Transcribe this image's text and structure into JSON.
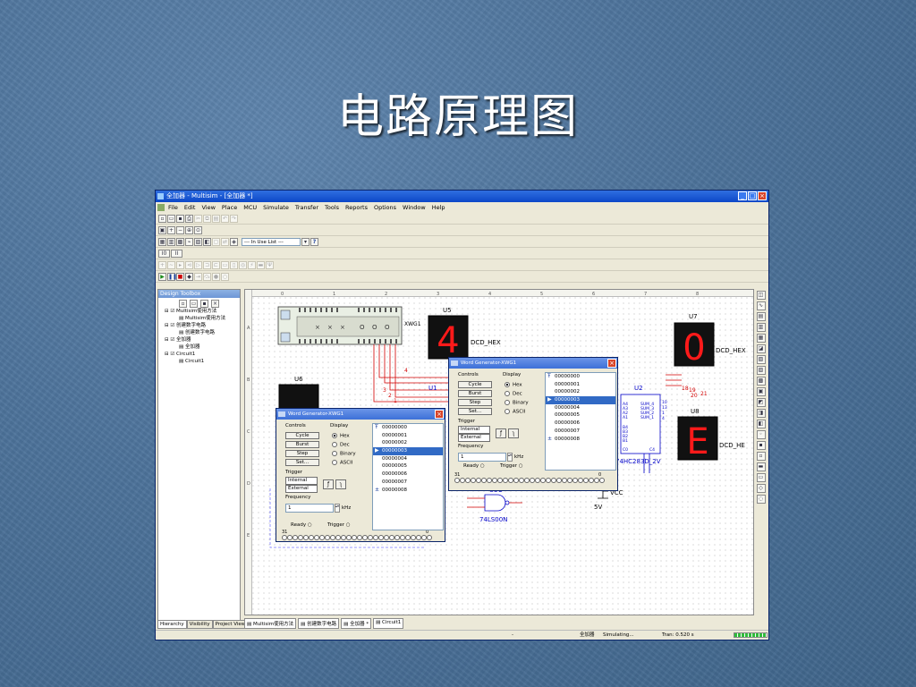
{
  "slide": {
    "title": "电路原理图"
  },
  "window": {
    "title": "全加器 - Multisim - [全加器 *]",
    "menu": [
      "File",
      "Edit",
      "View",
      "Place",
      "MCU",
      "Simulate",
      "Transfer",
      "Tools",
      "Reports",
      "Options",
      "Window",
      "Help"
    ],
    "in_use_list": "--- In Use List ---",
    "statusbar": {
      "sep": "-",
      "file": "全加器",
      "state": "Simulating...",
      "tran": "Tran: 0.520 s"
    }
  },
  "toolbox": {
    "title": "Design Toolbox",
    "tree": [
      {
        "level": 1,
        "label": "Multisim使用方法"
      },
      {
        "level": 2,
        "label": "Multisim使用方法"
      },
      {
        "level": 1,
        "label": "创建数字电路"
      },
      {
        "level": 2,
        "label": "创建数字电路"
      },
      {
        "level": 1,
        "label": "全加器"
      },
      {
        "level": 2,
        "label": "全加器"
      },
      {
        "level": 1,
        "label": "Circuit1"
      },
      {
        "level": 2,
        "label": "Circuit1"
      }
    ],
    "tabs": [
      "Hierarchy",
      "Visibility",
      "Project View"
    ]
  },
  "bottom_tabs": [
    "Multisim使用方法",
    "创建数字电路",
    "全加器 *",
    "Circuit1"
  ],
  "ruler": {
    "cols": [
      "0",
      "1",
      "2",
      "3",
      "4",
      "5",
      "6",
      "7",
      "8"
    ],
    "rows": [
      "A",
      "B",
      "C",
      "D",
      "E"
    ]
  },
  "schematic": {
    "xwg_label": "XWG1",
    "xwg_symbols": [
      "×",
      "×",
      "×",
      "O",
      "O",
      "O"
    ],
    "u5": {
      "name": "U5",
      "digit": "4",
      "label": "DCD_HEX"
    },
    "u6": {
      "name": "U6"
    },
    "u7": {
      "name": "U7",
      "digit": "0",
      "label": "DCD_HEX"
    },
    "u8": {
      "name": "U8",
      "digit": "E",
      "label": "DCD_HE"
    },
    "u1": {
      "name": "U1"
    },
    "u2": {
      "name": "U2",
      "part": "74HC283D_2V",
      "pins_left": [
        "A4",
        "A3",
        "A2",
        "A1",
        "",
        "B4",
        "B3",
        "B2",
        "B1",
        "",
        "C0"
      ],
      "pins_right": [
        "SUM_4",
        "SUM_3",
        "SUM_2",
        "SUM_1",
        "",
        "",
        "",
        "",
        "",
        "",
        "C4"
      ],
      "pin_nums": [
        "10",
        "13",
        "1",
        "4"
      ]
    },
    "u3c": {
      "name": "U3C",
      "part": "74LS00N"
    },
    "vcc": {
      "label": "VCC",
      "value": "5V"
    },
    "net_labels": [
      "4",
      "3",
      "2",
      "1",
      "18",
      "19",
      "20",
      "21"
    ],
    "mini_label": "C"
  },
  "word_generator_a": {
    "title": "Word Generator-XWG1",
    "controls_label": "Controls",
    "buttons": [
      "Cycle",
      "Burst",
      "Step",
      "Set..."
    ],
    "display_label": "Display",
    "display_options": [
      "Hex",
      "Dec",
      "Binary",
      "ASCII"
    ],
    "display_selected": "Hex",
    "trigger_label": "Trigger",
    "trigger_options": [
      "Internal",
      "External"
    ],
    "edge_rise": "ƒ",
    "edge_fall": "ʅ",
    "frequency_label": "Frequency",
    "frequency_value": "1",
    "frequency_unit": "kHz",
    "words": [
      "00000000",
      "00000001",
      "00000002",
      "00000003",
      "00000004",
      "00000005",
      "00000006",
      "00000007",
      "00000008"
    ],
    "selected_index": 3,
    "ready_label": "Ready",
    "trigger_ind_label": "Trigger",
    "pin_left": "31",
    "pin_right": "0"
  },
  "word_generator_b": {
    "title": "Word Generator-XWG1",
    "controls_label": "Controls",
    "buttons": [
      "Cycle",
      "Burst",
      "Step",
      "Set..."
    ],
    "display_label": "Display",
    "display_options": [
      "Hex",
      "Dec",
      "Binary",
      "ASCII"
    ],
    "display_selected": "Hex",
    "trigger_label": "Trigger",
    "trigger_options": [
      "Internal",
      "External"
    ],
    "edge_rise": "ƒ",
    "edge_fall": "ʅ",
    "frequency_label": "Frequency",
    "frequency_value": "1",
    "frequency_unit": "kHz",
    "words": [
      "00000000",
      "00000001",
      "00000002",
      "00000003",
      "00000004",
      "00000005",
      "00000006",
      "00000007",
      "00000008"
    ],
    "selected_index": 3,
    "ready_label": "Ready",
    "trigger_ind_label": "Trigger",
    "pin_left": "31",
    "pin_right": "0"
  },
  "colors": {
    "wire_red": "#d20000",
    "wire_blue": "#0000c8",
    "seg_on": "#ff1a1a",
    "title_blue": "#0c47c8"
  },
  "icons": [
    "new-icon",
    "open-icon",
    "save-icon",
    "print-icon",
    "zoom-in-icon",
    "zoom-out-icon",
    "run-icon",
    "pause-icon",
    "stop-icon",
    "help-icon"
  ]
}
